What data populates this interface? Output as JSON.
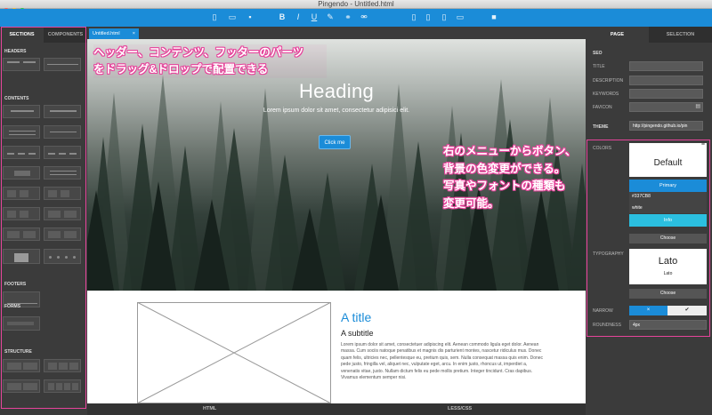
{
  "window": {
    "title": "Pingendo - Untitled.html"
  },
  "toolbar": {
    "icons": [
      "new-file-icon",
      "open-folder-icon",
      "save-icon",
      "bold-icon",
      "italic-icon",
      "underline-icon",
      "clear-format-icon",
      "link-icon",
      "unlink-icon",
      "desktop-icon",
      "tablet-icon",
      "phone-icon",
      "monitor-icon",
      "folder-icon"
    ],
    "glyphs": [
      "▯",
      "▭",
      "▪",
      "B",
      "I",
      "U",
      "✎",
      "⚭",
      "⚮",
      "▯",
      "▯",
      "▯",
      "▭",
      "■"
    ]
  },
  "left": {
    "tabs": [
      "SECTIONS",
      "COMPONENTS"
    ],
    "headers_label": "HEADERS",
    "contents_label": "CONTENTS",
    "footers_label": "FOOTERS",
    "forms_label": "FORMS",
    "structure_label": "STRUCTURE"
  },
  "editor": {
    "tab_label": "Untitled.html",
    "tab_close": "×",
    "hero_heading": "Heading",
    "hero_lead": "Lorem ipsum dolor sit amet, consectetur adipisici elit.",
    "hero_button": "Click me",
    "section_title": "A title",
    "section_subtitle": "A subtitle",
    "section_body": "Lorem ipsum dolor sit amet, consectetuer adipiscing elit. Aenean commodo ligula eget dolor. Aenean massa. Cum sociis natoque penatibus et magnis dis parturient montes, nascetur ridiculus mus. Donec quam felis, ultricies nec, pellentesque eu, pretium quis, sem. Nulla consequat massa quis enim. Donec pede justo, fringilla vel, aliquet nec, vulputate eget, arcu. In enim justo, rhoncus ut, imperdiet a, venenatis vitae, justo. Nullam dictum felis eu pede mollis pretium. Integer tincidunt. Cras dapibus. Vivamus elementum semper nisi."
  },
  "bottom_tabs": [
    "HTML",
    "LESS/CSS"
  ],
  "annotations": {
    "left_lines": [
      "ヘッダー、コンテンツ、フッターのパーツ",
      "をドラッグ&ドロップで配置できる"
    ],
    "right_lines": [
      "右のメニューからボタン、",
      "背景の色変更ができる。",
      "写真やフォントの種類も",
      "変更可能。"
    ]
  },
  "right": {
    "tabs": [
      "PAGE",
      "SELECTION"
    ],
    "seo_label": "SEO",
    "title_label": "TITLE",
    "description_label": "DESCRIPTION",
    "keywords_label": "KEYWORDS",
    "favicon_label": "FAVICON",
    "theme_label": "THEME",
    "theme_value": "http://pingendo.github.io/pin",
    "colors_label": "COLORS",
    "colors_card_text": "Default",
    "primary_label": "Primary",
    "swatch_hex": "#337CB8",
    "swatch_name": "white",
    "info_label": "Info",
    "choose_label": "Choose",
    "typography_label": "TYPOGRAPHY",
    "font_name": "Lato",
    "font_small": "Lato",
    "narrow_label": "NARROW",
    "roundness_label": "ROUNDNESS",
    "roundness_value": "4px",
    "narrow_off": "×",
    "narrow_on": "✔",
    "menu_icon": "≡",
    "favicon_icon": "▤"
  },
  "colors": {
    "accent": "#1b8cd8",
    "annotation": "#e6449b",
    "info": "#2bbfe0"
  }
}
